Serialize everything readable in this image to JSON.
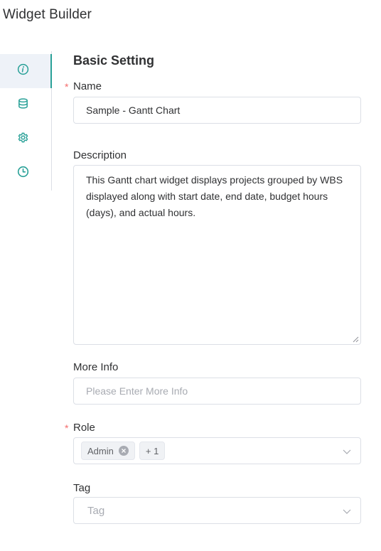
{
  "app": {
    "title": "Widget Builder"
  },
  "side_nav": {
    "items": [
      {
        "icon": "info-icon",
        "active": true
      },
      {
        "icon": "database-icon",
        "active": false
      },
      {
        "icon": "gear-icon",
        "active": false
      },
      {
        "icon": "clock-icon",
        "active": false
      }
    ]
  },
  "form": {
    "section_title": "Basic Setting",
    "required_mark": "*",
    "name": {
      "label": "Name",
      "value": "Sample - Gantt Chart"
    },
    "description": {
      "label": "Description",
      "value": "This Gantt chart widget displays projects grouped by WBS displayed along with start date, end date, budget hours (days), and actual hours."
    },
    "more_info": {
      "label": "More Info",
      "value": "",
      "placeholder": "Please Enter More Info"
    },
    "role": {
      "label": "Role",
      "tags": [
        "Admin"
      ],
      "extra_count": "+ 1"
    },
    "tag": {
      "label": "Tag",
      "placeholder": "Tag"
    }
  },
  "colors": {
    "accent": "#2aa198",
    "required": "#f56c6c",
    "active_bg": "#eef2f8"
  }
}
